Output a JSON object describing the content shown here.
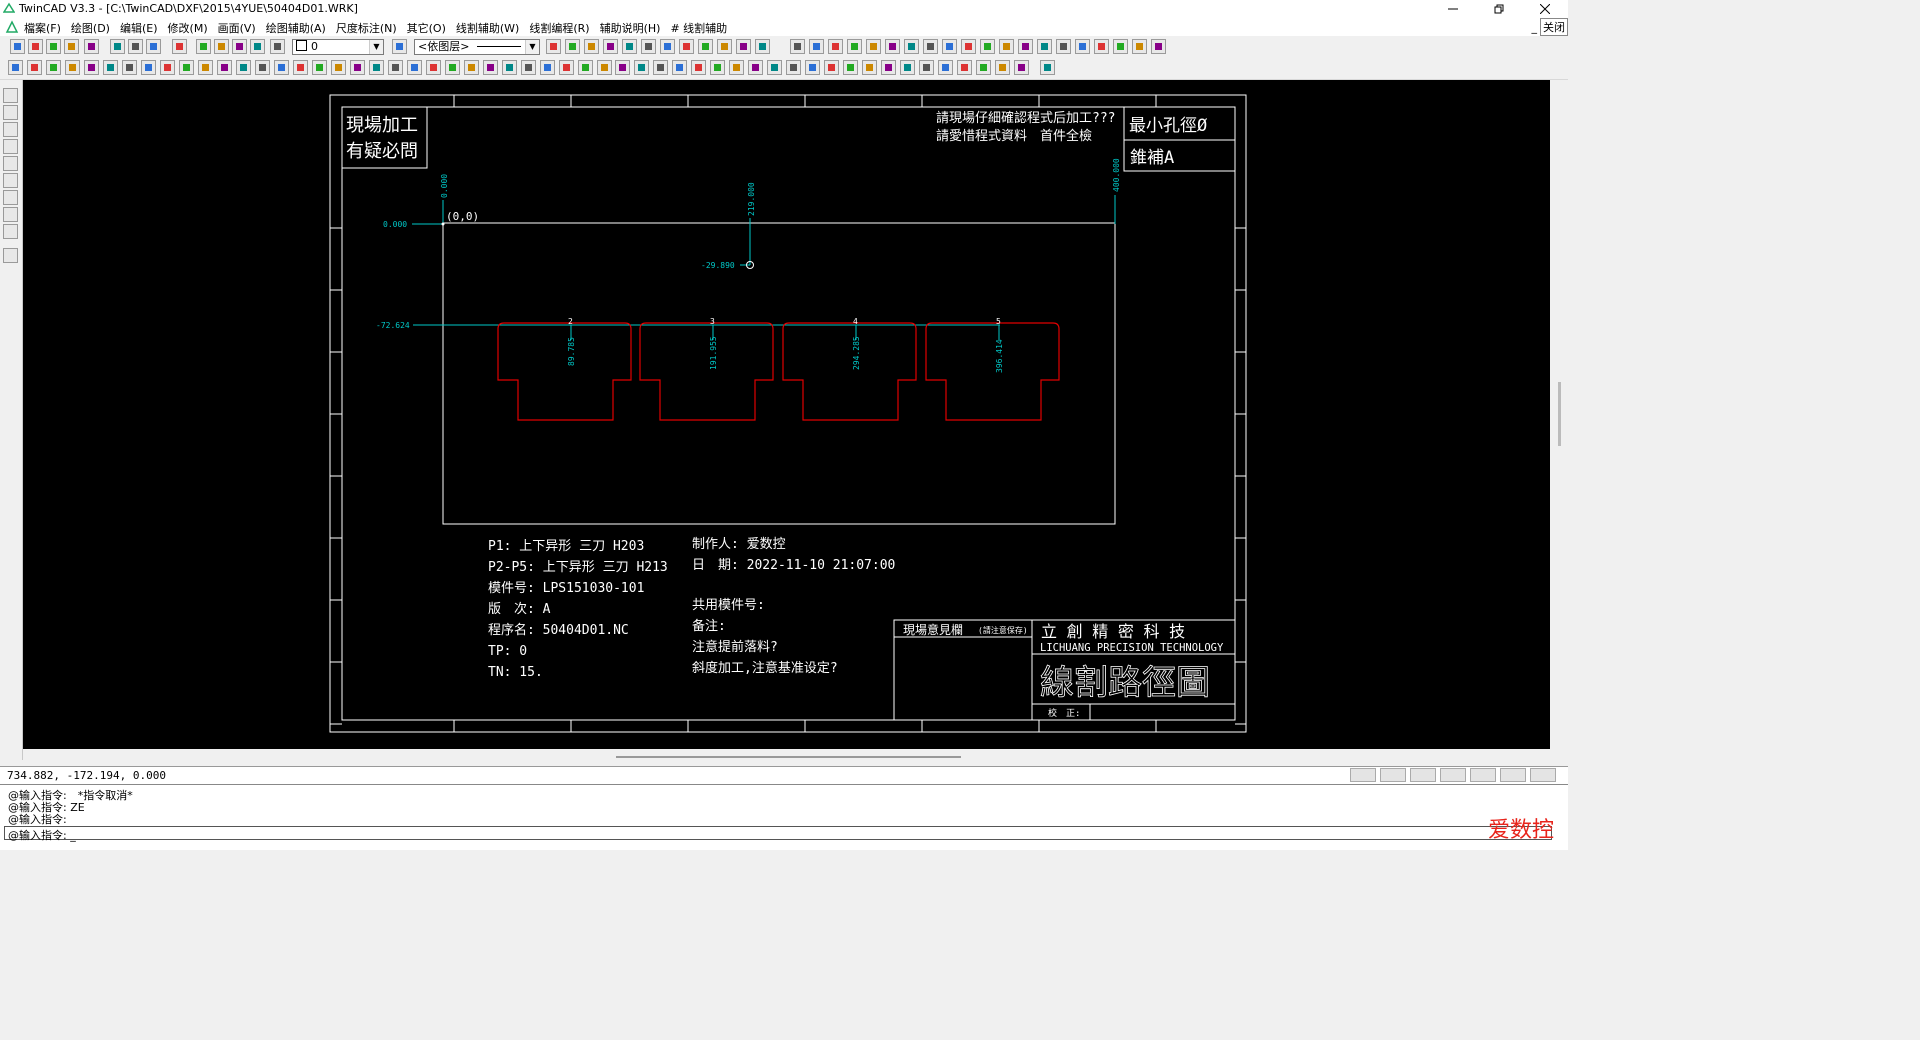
{
  "window": {
    "title": "TwinCAD V3.3 - [C:\\TwinCAD\\DXF\\2015\\4YUE\\50404D01.WRK]"
  },
  "menus": [
    "檔案(F)",
    "绘图(D)",
    "编辑(E)",
    "修改(M)",
    "画面(V)",
    "绘图辅助(A)",
    "尺度标注(N)",
    "其它(O)",
    "线割辅助(W)",
    "线割编程(R)",
    "辅助说明(H)",
    "# 线割辅助"
  ],
  "menu_right": {
    "close_label": "关闭"
  },
  "toolbar": {
    "layer_value": "0",
    "color_value": "<依图层>"
  },
  "drawing": {
    "header_left": [
      "現場加工",
      "有疑必問"
    ],
    "header_notes": [
      "請現場仔細確認程式后加工???",
      "請愛惜程式資料　首件全檢"
    ],
    "header_right": [
      "最小孔徑Ø",
      "錐補A"
    ],
    "dims": {
      "x_origin": "0.000",
      "x_mid": "219.000",
      "x_right": "400.000",
      "y_zero": "0.000",
      "origin_label": "(0,0)",
      "y_hole": "-29.890",
      "y_row": "-72.624",
      "p2": "89.785",
      "p3": "191.955",
      "p4": "294.285",
      "p5": "396.414"
    },
    "point_labels": [
      "2",
      "3",
      "4",
      "5"
    ],
    "info_left": [
      "P1: 上下异形 三刀 H203",
      "P2-P5: 上下异形 三刀 H213",
      "模件号: LPS151030-101",
      "版　次: A",
      "程序名: 50404D01.NC",
      "TP: 0",
      "TN: 15."
    ],
    "info_right": [
      "制作人: 爱数控",
      "日　期: 2022-11-10 21:07:00",
      "",
      "共用模件号:",
      "备注:",
      "注意提前落料?",
      "斜度加工,注意基准设定?"
    ],
    "opinion_label": "現場意見欄",
    "opinion_note": "(請注意保存)",
    "company_cn": "立 創 精 密 科 技",
    "company_en": "LICHUANG PRECISION TECHNOLOGY",
    "drawing_title": "線割路徑圖",
    "check_label": "校　正:"
  },
  "status": {
    "coords": "734.882, -172.194, 0.000"
  },
  "command_history": [
    "@输入指令:　*指令取消*",
    "@输入指令: ZE",
    "@输入指令:",
    "@输入指令: _"
  ],
  "watermark": "爱数控",
  "colors": {
    "canvas": "#000000",
    "frame": "#ffffff",
    "dims": "#00c8c8",
    "profile": "#e00000"
  }
}
